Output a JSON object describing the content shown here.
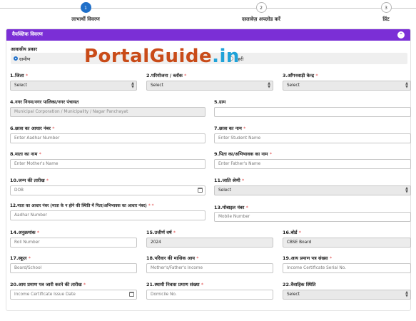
{
  "stepper": {
    "steps": [
      {
        "number": "1",
        "label": "लाभार्थी विवरण"
      },
      {
        "number": "2",
        "label": "दस्तावेज़ अपलोड करें"
      },
      {
        "number": "3",
        "label": "प्रिंट"
      }
    ],
    "active_step": 1
  },
  "section": {
    "title": "वैयक्तिक विवरण",
    "toggle_icon": "chevron-up-icon"
  },
  "area_type": {
    "label": "आवासीय प्रकार",
    "options": [
      "ग्रामीण",
      "शहरी"
    ],
    "selected": "ग्रामीण"
  },
  "watermark": {
    "part1": "PortalGuide",
    "part2": ".in"
  },
  "fields": {
    "district": {
      "label": "1.जिला",
      "required": "*",
      "value": "Select"
    },
    "project_block": {
      "label": "2.परियोजना / ब्लॉक",
      "required": "*",
      "value": "Select"
    },
    "anganwadi": {
      "label": "3.आँगनवाड़ी केन्द्र",
      "required": "*",
      "value": "Select"
    },
    "municipal": {
      "label": "4.नगर निगम/नगर पालिका/नगर पंचायत",
      "placeholder": "Municipal Corporation / Municipality / Nagar Panchayat"
    },
    "village": {
      "label": "5.ग्राम",
      "placeholder": ""
    },
    "student_aadhar": {
      "label": "6.छात्रा का आधार नंबर",
      "required": "*",
      "placeholder": "Enter Aadhar Number"
    },
    "student_name": {
      "label": "7.छात्रा का नाम",
      "required": "*",
      "placeholder": "Enter Student Name"
    },
    "mother_name": {
      "label": "8.माता का नाम",
      "required": "*",
      "placeholder": "Enter Mother's Name"
    },
    "father_name": {
      "label": "9.पिता का/अभिभावक का नाम",
      "required": "*",
      "placeholder": "Enter Father's Name"
    },
    "dob": {
      "label": "10.जन्म की तारीख",
      "required": "*",
      "placeholder": "DOB"
    },
    "caste": {
      "label": "11.जाति श्रेणी",
      "required": "*",
      "value": "Select"
    },
    "mother_aadhar": {
      "label": "12.माता का आधार नंबर (माता के न होने की स्थिति में पिता/अभिभावक का आधार नंबर)",
      "required": "* *",
      "placeholder": "Aadhar Number"
    },
    "mobile": {
      "label": "13.मोबाइल नंबर",
      "required": "*",
      "placeholder": "Mobile Number"
    },
    "roll": {
      "label": "14.अनुक्रमांक",
      "required": "*",
      "placeholder": "Roll Number"
    },
    "pass_year": {
      "label": "15.उत्तीर्ण वर्ष",
      "required": "*",
      "value": "2024"
    },
    "board": {
      "label": "16.बोर्ड",
      "required": "*",
      "value": "CBSE Board"
    },
    "school": {
      "label": "17.स्कूल",
      "required": "*",
      "placeholder": "Board/School"
    },
    "income": {
      "label": "18.परिवार की मासिक आय",
      "required": "*",
      "placeholder": "Mother's/Father's Income"
    },
    "income_cert_no": {
      "label": "19.आय प्रमाण पत्र संख्या",
      "required": "*",
      "placeholder": "Income Certificate Serial No."
    },
    "income_cert_date": {
      "label": "20.आय प्रमाण पत्र जारी करने की तारीख",
      "required": "*",
      "placeholder": "Income Certificate Issue Date"
    },
    "domicile": {
      "label": "21.स्थायी निवास प्रमाण संख्या",
      "required": "*",
      "placeholder": "Domicile No."
    },
    "marital": {
      "label": "22.वैवाहिक स्थिति",
      "required": "",
      "value": "Select"
    }
  },
  "colors": {
    "accent": "#7b2fd6",
    "step_active": "#1f6fc9",
    "required": "#e04a4a"
  }
}
